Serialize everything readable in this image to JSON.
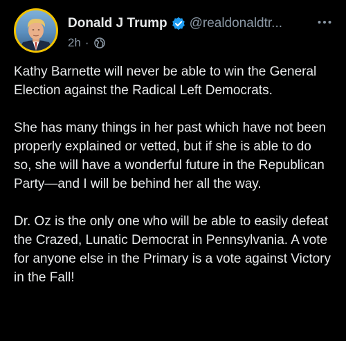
{
  "author": {
    "display_name": "Donald J Trump",
    "handle": "@realdonaldtr...",
    "verified_icon": "verified-badge-icon",
    "avatar": "profile-avatar",
    "accent_color": "#f2c200",
    "verified_color": "#1d9bf0"
  },
  "meta": {
    "timestamp": "2h",
    "separator": "·",
    "visibility_icon": "globe-icon"
  },
  "menu_icon": "more-options-icon",
  "post": {
    "paragraphs": [
      "Kathy Barnette will never be able to win the General Election against the Radical Left Democrats.",
      "She has many things in her past which have not been properly explained or vetted, but if she is able to do so, she will have a wonderful future in the Republican Party—and I will be behind her all the way.",
      "Dr. Oz is the only one who will be able to easily defeat the Crazed, Lunatic Democrat in Pennsylvania. A vote for anyone else in the Primary is a vote against Victory in the Fall!"
    ]
  }
}
